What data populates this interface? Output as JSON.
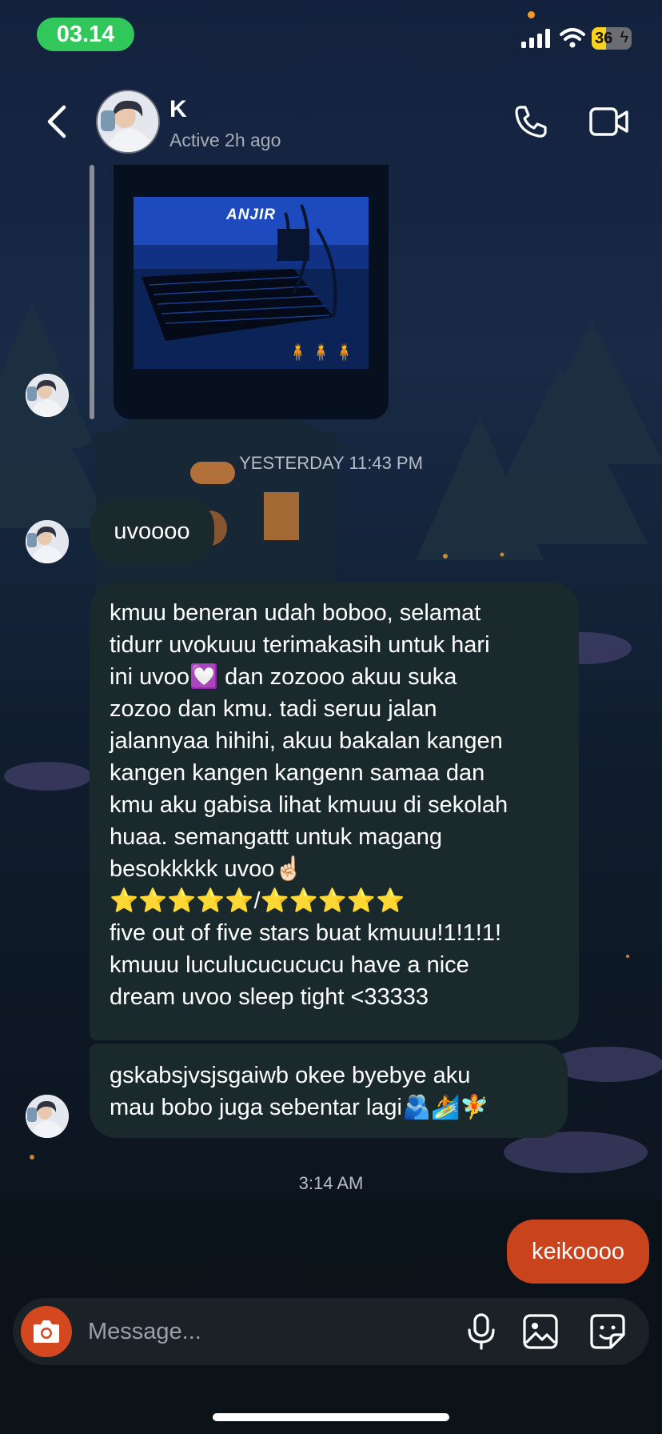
{
  "status_bar": {
    "time": "03.14",
    "battery": "36",
    "battery_level": 0.36
  },
  "header": {
    "contact_name": "K",
    "contact_status": "Active 2h ago",
    "icons": [
      "back-icon",
      "phone-icon",
      "video-camera-icon"
    ]
  },
  "shared_post": {
    "caption": "ANJIR",
    "figures": "🧍🧍🧍"
  },
  "messages": {
    "timestamp_1": "YESTERDAY 11:43 PM",
    "msg_1": "uvoooo",
    "msg_2_lines": [
      "kmuu beneran udah boboo, selamat",
      "tidurr uvokuuu terimakasih untuk hari",
      "ini uvoo💟 dan zozooo akuu suka",
      "zozoo dan kmu. tadi seruu jalan",
      "jalannyaa hihihi, akuu bakalan kangen",
      "kangen kangen kangenn samaa dan",
      "kmu aku gabisa lihat kmuuu di sekolah",
      "huaa. semangattt untuk magang",
      "besokkkkk uvoo☝🏻",
      "⭐⭐⭐⭐⭐/⭐⭐⭐⭐⭐",
      "five out of five stars buat kmuuu!1!1!1!",
      "kmuuu luculucucucucu have a nice",
      "dream uvoo sleep tight <33333"
    ],
    "msg_3_lines": [
      "gskabsjvsjsgaiwb okee byebye aku",
      "mau bobo juga sebentar lagi🫂🏄🧚"
    ],
    "timestamp_2": "3:14 AM",
    "msg_sent": "keikoooo"
  },
  "composer": {
    "placeholder": "Message...",
    "icons": [
      "camera-icon",
      "microphone-icon",
      "gallery-icon",
      "sticker-icon"
    ]
  },
  "colors": {
    "sent_bubble": "#c9441c",
    "received_bubble": "#1a2a2c",
    "status_pill": "#32c75a",
    "battery": "#f8d21c"
  }
}
